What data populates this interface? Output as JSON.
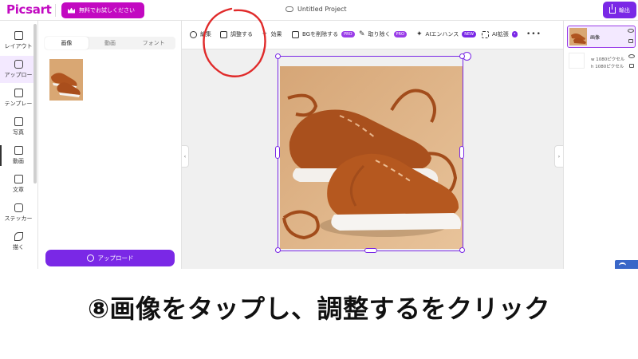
{
  "header": {
    "logo": "Picsart",
    "trial_label": "無料でお試しください",
    "project_title": "Untitled Project",
    "export_label": "輸出"
  },
  "rail": {
    "items": [
      {
        "label": "レイアウト",
        "icon": "layout-icon"
      },
      {
        "label": "アップロー",
        "icon": "upload-icon"
      },
      {
        "label": "テンプレー",
        "icon": "template-icon"
      },
      {
        "label": "写真",
        "icon": "photo-icon"
      },
      {
        "label": "動画",
        "icon": "video-icon"
      },
      {
        "label": "文章",
        "icon": "text-icon"
      },
      {
        "label": "ステッカー",
        "icon": "sticker-icon"
      },
      {
        "label": "描く",
        "icon": "brush-icon"
      }
    ]
  },
  "panel": {
    "tabs": [
      "画像",
      "動画",
      "フォント"
    ],
    "active_tab": "画像",
    "upload_label": "アップロード"
  },
  "toolbar": {
    "items": [
      {
        "label": "編集",
        "icon": "edit-icon"
      },
      {
        "label": "調整する",
        "icon": "adjust-icon"
      },
      {
        "label": "効果",
        "icon": "effects-icon"
      },
      {
        "label": "BGを削除する",
        "icon": "remove-bg-icon",
        "badge": "PRO"
      },
      {
        "label": "取り除く",
        "icon": "eraser-icon",
        "badge": "PRO"
      },
      {
        "label": "AIエンハンス",
        "icon": "ai-enhance-icon",
        "badge": "NEW"
      },
      {
        "label": "AI拡張",
        "icon": "ai-expand-icon"
      }
    ],
    "more_label": "•••"
  },
  "layers": {
    "selected_name": "画像",
    "width_label": "w 1080ピクセル",
    "height_label": "h 1080ピクセル"
  },
  "caption": {
    "text": "⑧画像をタップし、調整するをクリック"
  },
  "colors": {
    "brand": "#c209c1",
    "accent": "#7a28e6",
    "annotation": "#e02a2a"
  }
}
